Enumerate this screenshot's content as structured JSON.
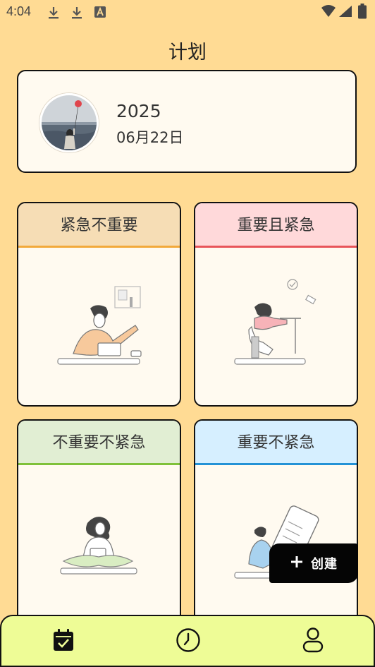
{
  "status_bar": {
    "time": "4:04",
    "left_icons": [
      "download-icon",
      "download-icon",
      "text-a-icon"
    ],
    "right_icons": [
      "wifi-icon",
      "cellular-signal-icon",
      "battery-icon"
    ]
  },
  "header": {
    "title": "计划"
  },
  "date_card": {
    "year": "2025",
    "month_day": "06月22日",
    "avatar": "avatar-girl-with-balloon"
  },
  "quadrants": [
    {
      "label": "紧急不重要",
      "header_color": "#f6ddb5",
      "accent": "#f2a93b"
    },
    {
      "label": "重要且紧急",
      "header_color": "#ffd9da",
      "accent": "#e8555a"
    },
    {
      "label": "不重要不紧急",
      "header_color": "#e1eed3",
      "accent": "#7fc13a"
    },
    {
      "label": "重要不紧急",
      "header_color": "#d6efff",
      "accent": "#2492d6"
    }
  ],
  "fab": {
    "label": "创建",
    "icon": "plus-icon"
  },
  "bottom_nav": {
    "items": [
      "calendar-check-icon",
      "clock-icon",
      "user-icon"
    ]
  }
}
